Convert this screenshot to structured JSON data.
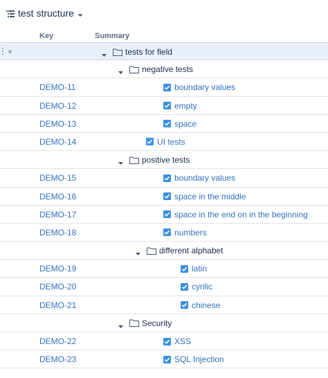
{
  "header": {
    "title": "test structure",
    "title_icon": "structure-icon",
    "menu_icon": "caret-down-icon"
  },
  "columns": {
    "key": "Key",
    "summary": "Summary"
  },
  "colors": {
    "link": "#2f6fbd",
    "checkbox": "#3b8fe0",
    "selected_row": "#e9f0fb",
    "border": "#dfe1e6"
  },
  "rows": [
    {
      "type": "folder",
      "key": "",
      "label": "tests for field",
      "depth": 0,
      "expanded": true,
      "selected": true
    },
    {
      "type": "folder",
      "key": "",
      "label": "negative tests",
      "depth": 1,
      "expanded": true
    },
    {
      "type": "issue",
      "key": "DEMO-11",
      "label": "boundary values",
      "depth": 2,
      "checked": true
    },
    {
      "type": "issue",
      "key": "DEMO-12",
      "label": "empty",
      "depth": 2,
      "checked": true
    },
    {
      "type": "issue",
      "key": "DEMO-13",
      "label": "space",
      "depth": 2,
      "checked": true
    },
    {
      "type": "issue",
      "key": "DEMO-14",
      "label": "UI tests",
      "depth": 1,
      "checked": true
    },
    {
      "type": "folder",
      "key": "",
      "label": "positive tests",
      "depth": 1,
      "expanded": true
    },
    {
      "type": "issue",
      "key": "DEMO-15",
      "label": "boundary values",
      "depth": 2,
      "checked": true
    },
    {
      "type": "issue",
      "key": "DEMO-16",
      "label": "space in the middle",
      "depth": 2,
      "checked": true
    },
    {
      "type": "issue",
      "key": "DEMO-17",
      "label": "space in the end on in the beginning",
      "depth": 2,
      "checked": true
    },
    {
      "type": "issue",
      "key": "DEMO-18",
      "label": "numbers",
      "depth": 2,
      "checked": true
    },
    {
      "type": "folder",
      "key": "",
      "label": "different alphabet",
      "depth": 2,
      "expanded": true
    },
    {
      "type": "issue",
      "key": "DEMO-19",
      "label": "latin",
      "depth": 3,
      "checked": true
    },
    {
      "type": "issue",
      "key": "DEMO-20",
      "label": "cyrilic",
      "depth": 3,
      "checked": true
    },
    {
      "type": "issue",
      "key": "DEMO-21",
      "label": "chinese",
      "depth": 3,
      "checked": true
    },
    {
      "type": "folder",
      "key": "",
      "label": "Security",
      "depth": 1,
      "expanded": true
    },
    {
      "type": "issue",
      "key": "DEMO-22",
      "label": "XSS",
      "depth": 2,
      "checked": true
    },
    {
      "type": "issue",
      "key": "DEMO-23",
      "label": "SQL Injection",
      "depth": 2,
      "checked": true
    }
  ]
}
